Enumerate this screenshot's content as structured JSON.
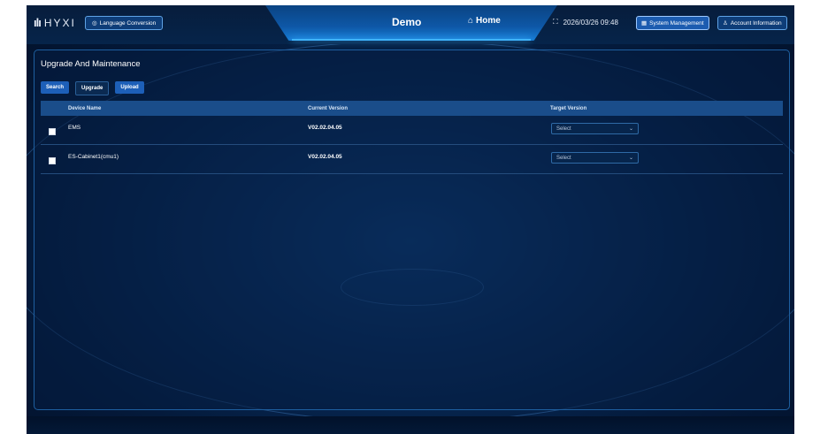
{
  "header": {
    "logo_text": "HYXI",
    "language_button": "Language Conversion",
    "title": "Demo",
    "home_label": "Home",
    "datetime": "2026/03/26 09:48",
    "system_button": "System Management",
    "account_button": "Account Information"
  },
  "panel": {
    "title": "Upgrade And Maintenance",
    "actions": {
      "search": "Search",
      "upgrade": "Upgrade",
      "upload": "Upload"
    },
    "columns": {
      "device_name": "Device Name",
      "current_version": "Current Version",
      "target_version": "Target Version"
    },
    "rows": [
      {
        "device_name": "EMS",
        "current_version": "V02.02.04.05",
        "target_placeholder": "Select"
      },
      {
        "device_name": "ES-Cabinet1(cmu1)",
        "current_version": "V02.02.04.05",
        "target_placeholder": "Select"
      }
    ]
  },
  "colors": {
    "accent": "#1d5fb8",
    "background": "#072a57",
    "header_row": "#1a4d8a"
  }
}
